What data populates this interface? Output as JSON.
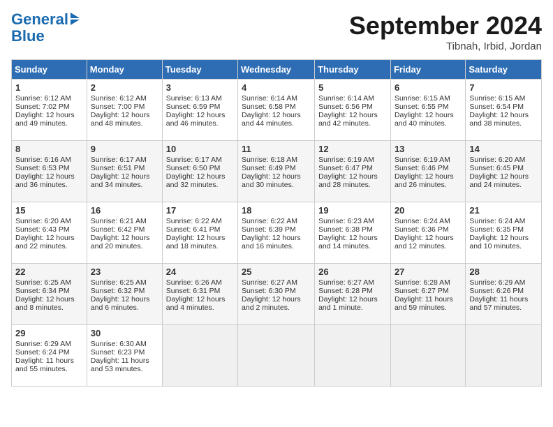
{
  "logo": {
    "line1": "General",
    "line2": "Blue"
  },
  "title": "September 2024",
  "location": "Tibnah, Irbid, Jordan",
  "days_header": [
    "Sunday",
    "Monday",
    "Tuesday",
    "Wednesday",
    "Thursday",
    "Friday",
    "Saturday"
  ],
  "weeks": [
    [
      {
        "day": "1",
        "sunrise": "6:12 AM",
        "sunset": "7:02 PM",
        "daylight": "Daylight: 12 hours and 49 minutes."
      },
      {
        "day": "2",
        "sunrise": "6:12 AM",
        "sunset": "7:00 PM",
        "daylight": "Daylight: 12 hours and 48 minutes."
      },
      {
        "day": "3",
        "sunrise": "6:13 AM",
        "sunset": "6:59 PM",
        "daylight": "Daylight: 12 hours and 46 minutes."
      },
      {
        "day": "4",
        "sunrise": "6:14 AM",
        "sunset": "6:58 PM",
        "daylight": "Daylight: 12 hours and 44 minutes."
      },
      {
        "day": "5",
        "sunrise": "6:14 AM",
        "sunset": "6:56 PM",
        "daylight": "Daylight: 12 hours and 42 minutes."
      },
      {
        "day": "6",
        "sunrise": "6:15 AM",
        "sunset": "6:55 PM",
        "daylight": "Daylight: 12 hours and 40 minutes."
      },
      {
        "day": "7",
        "sunrise": "6:15 AM",
        "sunset": "6:54 PM",
        "daylight": "Daylight: 12 hours and 38 minutes."
      }
    ],
    [
      {
        "day": "8",
        "sunrise": "6:16 AM",
        "sunset": "6:53 PM",
        "daylight": "Daylight: 12 hours and 36 minutes."
      },
      {
        "day": "9",
        "sunrise": "6:17 AM",
        "sunset": "6:51 PM",
        "daylight": "Daylight: 12 hours and 34 minutes."
      },
      {
        "day": "10",
        "sunrise": "6:17 AM",
        "sunset": "6:50 PM",
        "daylight": "Daylight: 12 hours and 32 minutes."
      },
      {
        "day": "11",
        "sunrise": "6:18 AM",
        "sunset": "6:49 PM",
        "daylight": "Daylight: 12 hours and 30 minutes."
      },
      {
        "day": "12",
        "sunrise": "6:19 AM",
        "sunset": "6:47 PM",
        "daylight": "Daylight: 12 hours and 28 minutes."
      },
      {
        "day": "13",
        "sunrise": "6:19 AM",
        "sunset": "6:46 PM",
        "daylight": "Daylight: 12 hours and 26 minutes."
      },
      {
        "day": "14",
        "sunrise": "6:20 AM",
        "sunset": "6:45 PM",
        "daylight": "Daylight: 12 hours and 24 minutes."
      }
    ],
    [
      {
        "day": "15",
        "sunrise": "6:20 AM",
        "sunset": "6:43 PM",
        "daylight": "Daylight: 12 hours and 22 minutes."
      },
      {
        "day": "16",
        "sunrise": "6:21 AM",
        "sunset": "6:42 PM",
        "daylight": "Daylight: 12 hours and 20 minutes."
      },
      {
        "day": "17",
        "sunrise": "6:22 AM",
        "sunset": "6:41 PM",
        "daylight": "Daylight: 12 hours and 18 minutes."
      },
      {
        "day": "18",
        "sunrise": "6:22 AM",
        "sunset": "6:39 PM",
        "daylight": "Daylight: 12 hours and 16 minutes."
      },
      {
        "day": "19",
        "sunrise": "6:23 AM",
        "sunset": "6:38 PM",
        "daylight": "Daylight: 12 hours and 14 minutes."
      },
      {
        "day": "20",
        "sunrise": "6:24 AM",
        "sunset": "6:36 PM",
        "daylight": "Daylight: 12 hours and 12 minutes."
      },
      {
        "day": "21",
        "sunrise": "6:24 AM",
        "sunset": "6:35 PM",
        "daylight": "Daylight: 12 hours and 10 minutes."
      }
    ],
    [
      {
        "day": "22",
        "sunrise": "6:25 AM",
        "sunset": "6:34 PM",
        "daylight": "Daylight: 12 hours and 8 minutes."
      },
      {
        "day": "23",
        "sunrise": "6:25 AM",
        "sunset": "6:32 PM",
        "daylight": "Daylight: 12 hours and 6 minutes."
      },
      {
        "day": "24",
        "sunrise": "6:26 AM",
        "sunset": "6:31 PM",
        "daylight": "Daylight: 12 hours and 4 minutes."
      },
      {
        "day": "25",
        "sunrise": "6:27 AM",
        "sunset": "6:30 PM",
        "daylight": "Daylight: 12 hours and 2 minutes."
      },
      {
        "day": "26",
        "sunrise": "6:27 AM",
        "sunset": "6:28 PM",
        "daylight": "Daylight: 12 hours and 1 minute."
      },
      {
        "day": "27",
        "sunrise": "6:28 AM",
        "sunset": "6:27 PM",
        "daylight": "Daylight: 11 hours and 59 minutes."
      },
      {
        "day": "28",
        "sunrise": "6:29 AM",
        "sunset": "6:26 PM",
        "daylight": "Daylight: 11 hours and 57 minutes."
      }
    ],
    [
      {
        "day": "29",
        "sunrise": "6:29 AM",
        "sunset": "6:24 PM",
        "daylight": "Daylight: 11 hours and 55 minutes."
      },
      {
        "day": "30",
        "sunrise": "6:30 AM",
        "sunset": "6:23 PM",
        "daylight": "Daylight: 11 hours and 53 minutes."
      },
      {
        "day": "",
        "sunrise": "",
        "sunset": "",
        "daylight": ""
      },
      {
        "day": "",
        "sunrise": "",
        "sunset": "",
        "daylight": ""
      },
      {
        "day": "",
        "sunrise": "",
        "sunset": "",
        "daylight": ""
      },
      {
        "day": "",
        "sunrise": "",
        "sunset": "",
        "daylight": ""
      },
      {
        "day": "",
        "sunrise": "",
        "sunset": "",
        "daylight": ""
      }
    ]
  ]
}
